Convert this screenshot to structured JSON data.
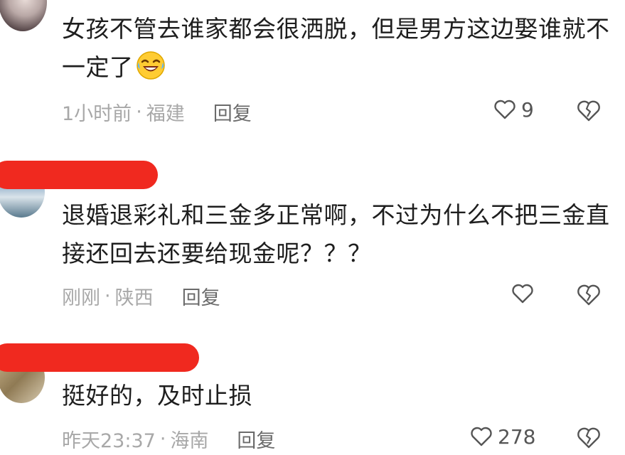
{
  "comments": [
    {
      "text": "女孩不管去谁家都会很洒脱，但是男方这边娶谁就不一定了",
      "emoji": "laughing-tears-emoji",
      "time": "1小时前",
      "location": "福建",
      "reply_label": "回复",
      "likes": "9"
    },
    {
      "text": "退婚退彩礼和三金多正常啊，不过为什么不把三金直接还回去还要给现金呢？？？",
      "time": "刚刚",
      "location": "陕西",
      "reply_label": "回复",
      "likes": ""
    },
    {
      "text": "挺好的，及时止损",
      "time": "昨天23:37",
      "location": "海南",
      "reply_label": "回复",
      "likes": "278"
    }
  ],
  "separator": "·",
  "colors": {
    "redaction": "#f0291f",
    "meta_text": "#a8a8a8",
    "reply_text": "#6b6b6b",
    "body_text": "#1e1e1e"
  },
  "icons": {
    "like": "heart-outline-icon",
    "dislike": "broken-heart-icon"
  }
}
